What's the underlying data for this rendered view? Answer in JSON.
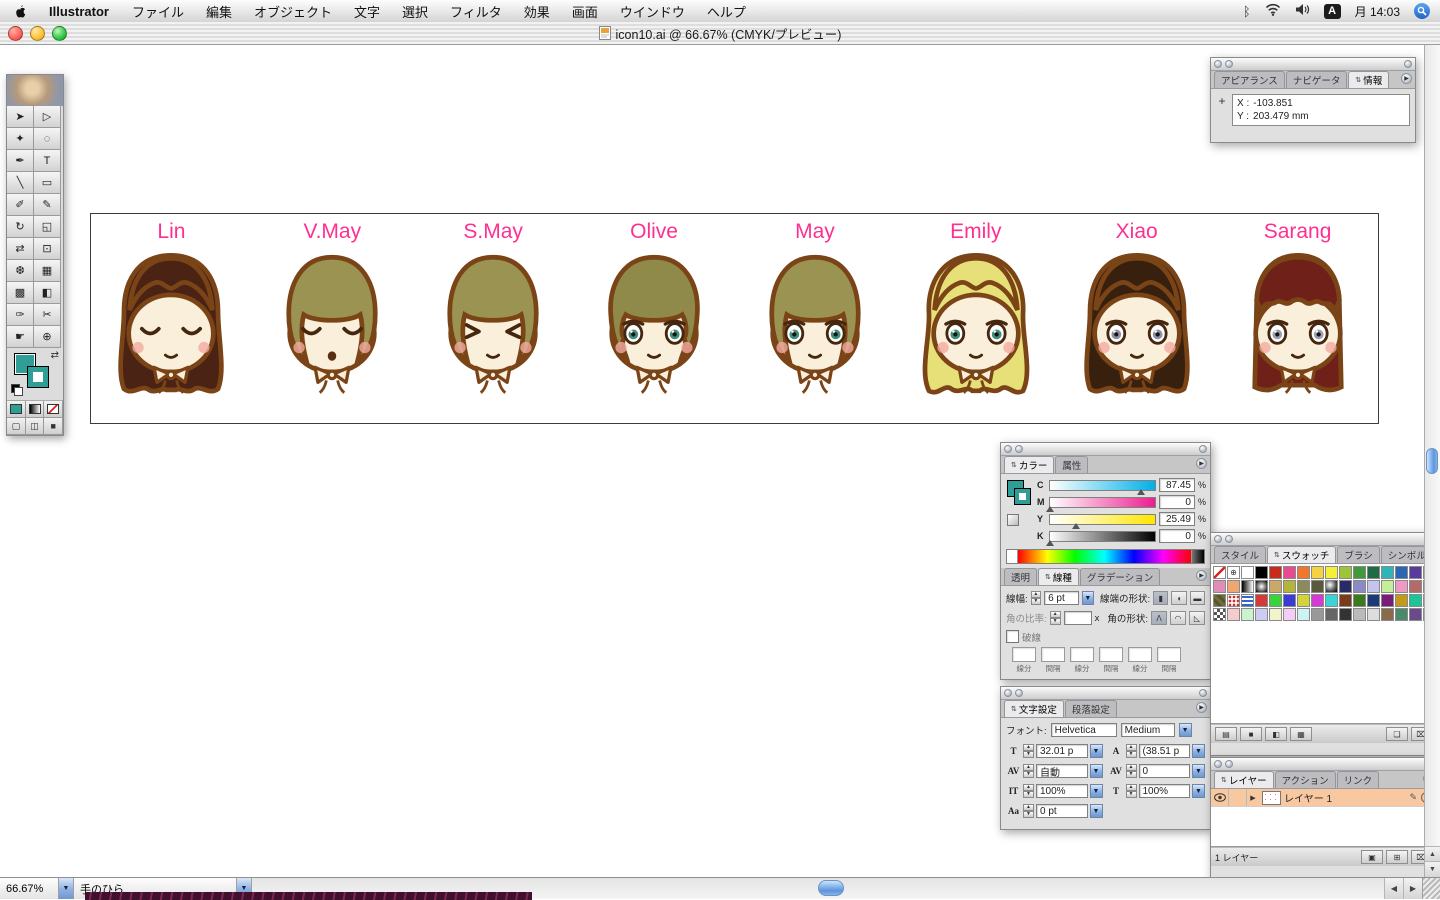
{
  "colors": {
    "accent_pink": "#ff2f92",
    "aqua": "#5a93d6",
    "teal_fill": "#2f9e96",
    "outline_brown": "#7a4417",
    "layer_highlight": "#f8c9a0"
  },
  "menu_bar": {
    "app_name": "Illustrator",
    "items": [
      "ファイル",
      "編集",
      "オブジェクト",
      "文字",
      "選択",
      "フィルタ",
      "効果",
      "画面",
      "ウインドウ",
      "ヘルプ"
    ],
    "input_badge": "A",
    "clock": "月 14:03"
  },
  "window": {
    "title": "icon10.ai @ 66.67% (CMYK/プレビュー)"
  },
  "toolbox": {
    "tools": [
      [
        "selection-tool",
        "➤"
      ],
      [
        "direct-selection-tool",
        "▷"
      ],
      [
        "magic-wand-tool",
        "✦"
      ],
      [
        "lasso-tool",
        "◌"
      ],
      [
        "pen-tool",
        "✒"
      ],
      [
        "type-tool",
        "T"
      ],
      [
        "line-tool",
        "╲"
      ],
      [
        "rectangle-tool",
        "▭"
      ],
      [
        "paintbrush-tool",
        "✐"
      ],
      [
        "pencil-tool",
        "✎"
      ],
      [
        "rotate-tool",
        "↻"
      ],
      [
        "scale-tool",
        "◱"
      ],
      [
        "reflect-tool",
        "⇄"
      ],
      [
        "free-transform-tool",
        "⊡"
      ],
      [
        "symbol-sprayer-tool",
        "❆"
      ],
      [
        "graph-tool",
        "▦"
      ],
      [
        "mesh-tool",
        "▩"
      ],
      [
        "gradient-tool",
        "◧"
      ],
      [
        "eyedropper-tool",
        "✑"
      ],
      [
        "scissors-tool",
        "✂"
      ],
      [
        "hand-tool",
        "☛"
      ],
      [
        "zoom-tool",
        "⊕"
      ]
    ]
  },
  "artboard": {
    "characters": [
      {
        "name": "Lin",
        "hair": "long",
        "hairColor": "#4a2315",
        "eye": "closed"
      },
      {
        "name": "V.May",
        "hair": "bob",
        "hairColor": "#9b9352",
        "eye": "closed",
        "mouth": "open"
      },
      {
        "name": "S.May",
        "hair": "bob",
        "hairColor": "#9b9352",
        "eye": "squint"
      },
      {
        "name": "Olive",
        "hair": "messy",
        "hairColor": "#8f8a4a",
        "eye": "open",
        "eyeColor": "#3f8f7a"
      },
      {
        "name": "May",
        "hair": "bob",
        "hairColor": "#9b9352",
        "eye": "open",
        "eyeColor": "#3f8f7a"
      },
      {
        "name": "Emily",
        "hair": "wavy",
        "hairColor": "#e7df77",
        "eye": "open",
        "eyeColor": "#3f8f7a"
      },
      {
        "name": "Xiao",
        "hair": "long",
        "hairColor": "#38200f",
        "eye": "open",
        "eyeColor": "#8d93a6"
      },
      {
        "name": "Sarang",
        "hair": "straight",
        "hairColor": "#6f2019",
        "eye": "open",
        "eyeColor": "#9aa2b2"
      }
    ]
  },
  "info_palette": {
    "tabs": [
      {
        "label": "アピアランス"
      },
      {
        "label": "ナビゲータ"
      },
      {
        "label": "情報",
        "active": true
      }
    ],
    "x_label": "X :",
    "x_value": "-103.851",
    "y_label": "Y :",
    "y_value": "203.479 mm"
  },
  "color_palette": {
    "tabs": [
      {
        "label": "カラー",
        "active": true
      },
      {
        "label": "属性"
      }
    ],
    "unit": "%",
    "channels": [
      {
        "label": "C",
        "value": "87.45",
        "pos": 87
      },
      {
        "label": "M",
        "value": "0",
        "pos": 0
      },
      {
        "label": "Y",
        "value": "25.49",
        "pos": 25
      },
      {
        "label": "K",
        "value": "0",
        "pos": 0
      }
    ]
  },
  "stroke_palette": {
    "tabs": [
      {
        "label": "透明"
      },
      {
        "label": "線種",
        "active": true
      },
      {
        "label": "グラデーション"
      }
    ],
    "weight_label": "線幅:",
    "weight_value": "6 pt",
    "cap_label": "線端の形状:",
    "miter_label": "角の比率:",
    "x_label": "x",
    "join_label": "角の形状:",
    "dash_label": "破線",
    "dash_fields": [
      "線分",
      "間隔",
      "線分",
      "間隔",
      "線分",
      "間隔"
    ]
  },
  "char_palette": {
    "tabs": [
      {
        "label": "文字設定",
        "active": true
      },
      {
        "label": "段落設定"
      }
    ],
    "font_label": "フォント:",
    "font_name": "Helvetica",
    "font_style": "Medium",
    "fields": [
      {
        "icon": "T",
        "value": "32.01 p"
      },
      {
        "icon": "A",
        "value": "(38.51 p"
      },
      {
        "icon": "AV",
        "value": "自動"
      },
      {
        "icon": "AV",
        "value": "0"
      },
      {
        "icon": "IT",
        "value": "100%"
      },
      {
        "icon": "T",
        "value": "100%"
      },
      {
        "icon": "Aa",
        "value": "0 pt"
      }
    ]
  },
  "swatches_palette": {
    "tabs": [
      {
        "label": "スタイル"
      },
      {
        "label": "スウォッチ",
        "active": true
      },
      {
        "label": "ブラシ"
      },
      {
        "label": "シンボル"
      }
    ],
    "swatches": [
      "none",
      "reg",
      "#ffffff",
      "#000000",
      "#c62b1c",
      "#e94a92",
      "#f2762c",
      "#f7d13f",
      "#f5ef3a",
      "#9ec438",
      "#3f9a3a",
      "#1e6b44",
      "#2fb5b5",
      "#2a66b3",
      "#5b3a9e",
      "#a03a9e",
      "#e08db8",
      "#f0a670",
      "grad-lin",
      "grad-rad",
      "#caa86a",
      "#b5b53a",
      "#8a8a5a",
      "#5a5a3a",
      "grad-sphere",
      "#2a2a66",
      "#8a8ac4",
      "#c4c4ee",
      "#c4ee9a",
      "#ee9ac4",
      "#b56a6a",
      "#9ac4c4",
      "pat-camo",
      "pat-dots",
      "pat-stripes",
      "#d43a3a",
      "#3ad43a",
      "#3a3ad4",
      "#d4d43a",
      "#d43ad4",
      "#3ad4d4",
      "#7a3a1c",
      "#3a7a1c",
      "#1c3a7a",
      "#7a1c7a",
      "#c49a1c",
      "#1cc49a",
      "#7a1cc4",
      "pat-check",
      "#f4cccc",
      "#ccf4cc",
      "#ccccf4",
      "#f4f4cc",
      "#f4ccf4",
      "#ccf4f4",
      "#999999",
      "#666666",
      "#333333",
      "#bbbbbb",
      "#dddddd",
      "#8a6a4a",
      "#4a8a6a",
      "#6a4a8a",
      "#aaaa88"
    ]
  },
  "layers_palette": {
    "tabs": [
      {
        "label": "レイヤー",
        "active": true
      },
      {
        "label": "アクション"
      },
      {
        "label": "リンク"
      }
    ],
    "layers": [
      {
        "name": "レイヤー 1"
      }
    ],
    "footer": "1 レイヤー"
  },
  "status_bar": {
    "zoom": "66.67%",
    "tool": "手のひら"
  }
}
